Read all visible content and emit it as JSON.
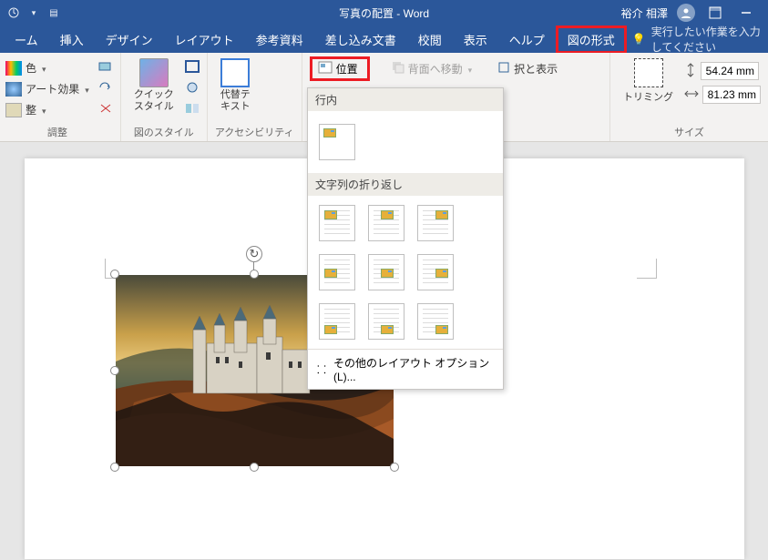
{
  "title": "写真の配置  -  Word",
  "user": "裕介 相澤",
  "tabs": [
    "ーム",
    "挿入",
    "デザイン",
    "レイアウト",
    "参考資料",
    "差し込み文書",
    "校閲",
    "表示",
    "ヘルプ",
    "図の形式"
  ],
  "tellme": "実行したい作業を入力してください",
  "ribbon": {
    "adjust": {
      "color": "色",
      "art": "アート効果",
      "fix": "整",
      "label": "調整"
    },
    "style": {
      "quick": "クイック\nスタイル",
      "label": "図のスタイル"
    },
    "acc": {
      "alt": "代替テ\nキスト",
      "label": "アクセシビリティ"
    },
    "arrange": {
      "position": "位置",
      "back": "背面へ移動",
      "selview": "択と表示"
    },
    "size": {
      "trim": "トリミング",
      "h": "54.24 mm",
      "w": "81.23 mm",
      "label": "サイズ"
    }
  },
  "menu": {
    "inline": "行内",
    "wrap": "文字列の折り返し",
    "more": "その他のレイアウト オプション(L)..."
  }
}
